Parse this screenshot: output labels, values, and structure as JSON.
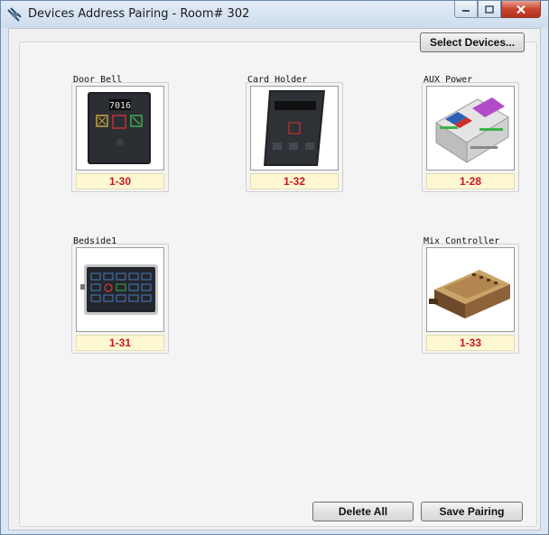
{
  "window": {
    "title": "Devices Address Pairing - Room# 302"
  },
  "toolbar": {
    "select_devices_label": "Select Devices..."
  },
  "devices": [
    {
      "name": "Door Bell",
      "address": "1-30",
      "icon": "door-bell-panel-icon"
    },
    {
      "name": "Card Holder",
      "address": "1-32",
      "icon": "card-holder-icon"
    },
    {
      "name": "AUX Power",
      "address": "1-28",
      "icon": "aux-power-module-icon"
    },
    {
      "name": "Bedside1",
      "address": "1-31",
      "icon": "bedside-panel-icon"
    },
    {
      "name": "Mix Controller",
      "address": "1-33",
      "icon": "mix-controller-icon"
    }
  ],
  "door_bell_display": "7016",
  "footer": {
    "delete_all_label": "Delete All",
    "save_pairing_label": "Save Pairing"
  },
  "colors": {
    "address_text": "#c8161e",
    "address_bg": "#fdf8d2",
    "close_button": "#c9452e"
  }
}
